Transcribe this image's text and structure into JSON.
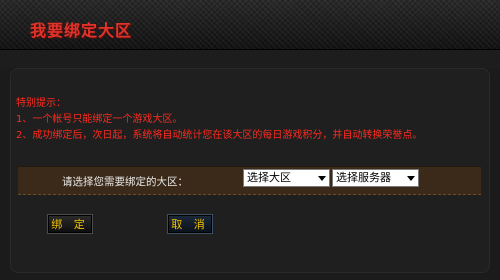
{
  "header": {
    "title": "我要绑定大区"
  },
  "tips": {
    "heading": "特别提示：",
    "items": [
      "1、一个帐号只能绑定一个游戏大区。",
      "2、成功绑定后，次日起，系统将自动统计您在该大区的每日游戏积分，并自动转换荣誉点。"
    ]
  },
  "form": {
    "label": "请选择您需要绑定的大区：",
    "region_select": "选择大区",
    "server_select": "选择服务器"
  },
  "buttons": {
    "bind": "绑 定",
    "cancel": "取 消"
  },
  "colors": {
    "title": "#e0342b",
    "tip_text": "#ff2a1e",
    "button_text": "#f2c200",
    "row_bg": "#3b2a19"
  }
}
